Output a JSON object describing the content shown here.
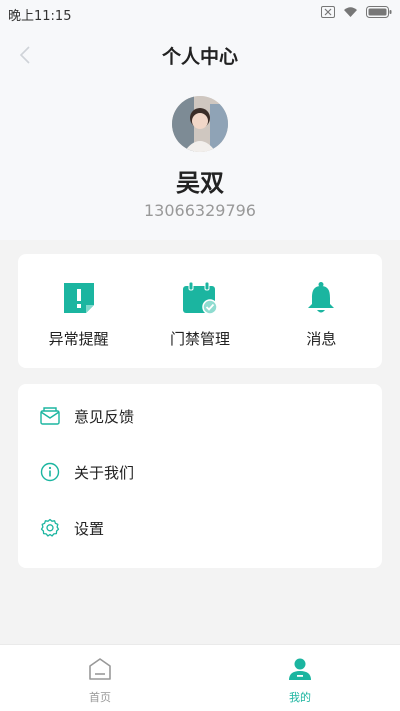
{
  "status_bar": {
    "time": "晚上11:15"
  },
  "header": {
    "title": "个人中心"
  },
  "profile": {
    "name": "吴双",
    "phone": "13066329796"
  },
  "shortcuts": [
    {
      "label": "异常提醒",
      "icon": "alert-flag-icon"
    },
    {
      "label": "门禁管理",
      "icon": "calendar-check-icon"
    },
    {
      "label": "消息",
      "icon": "bell-icon"
    }
  ],
  "menu": [
    {
      "label": "意见反馈",
      "icon": "mail-icon"
    },
    {
      "label": "关于我们",
      "icon": "info-icon"
    },
    {
      "label": "设置",
      "icon": "gear-icon"
    }
  ],
  "tabbar": [
    {
      "label": "首页",
      "icon": "home-icon",
      "active": false
    },
    {
      "label": "我的",
      "icon": "user-icon",
      "active": true
    }
  ],
  "colors": {
    "accent": "#1bb5a0",
    "background": "#f3f3f3",
    "header_bg": "#f7f8fa"
  }
}
